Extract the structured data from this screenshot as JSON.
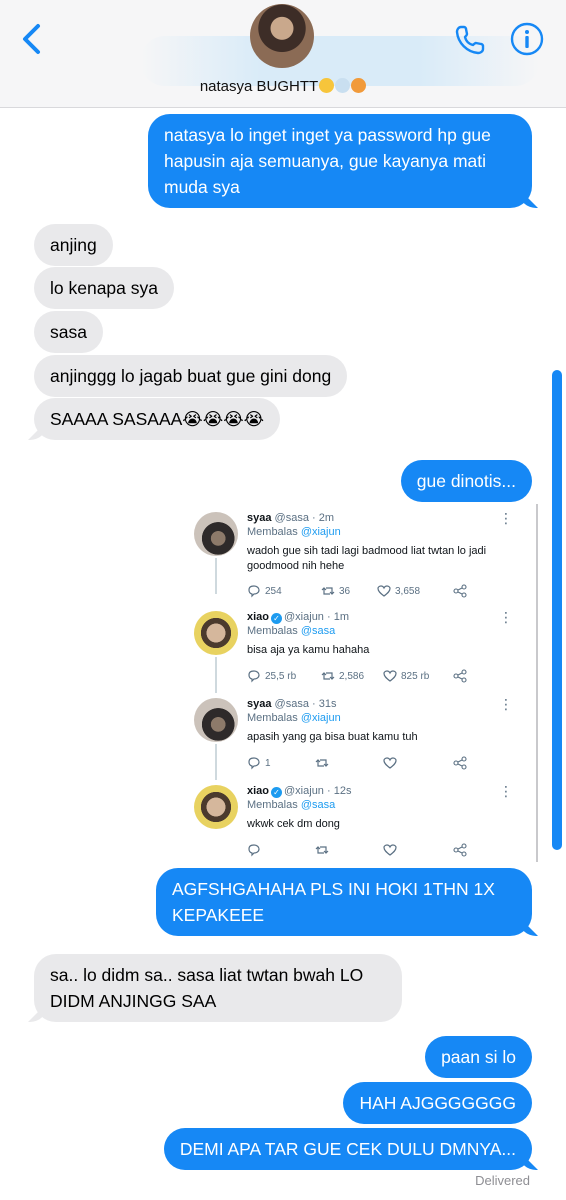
{
  "header": {
    "contact_name": "natasya BUGHTT",
    "emoji_names": [
      "hushed-face-emoji",
      "dash-emoji",
      "exploding-head-emoji"
    ],
    "back_icon": "chevron-left-icon",
    "call_icon": "phone-icon",
    "info_icon": "info-circle-icon",
    "accent_color": "#1688f5"
  },
  "messages": [
    {
      "dir": "out",
      "text": "natasya lo inget inget ya password hp gue hapusin aja semuanya, gue kayanya mati muda sya"
    },
    {
      "dir": "in",
      "text": "anjing"
    },
    {
      "dir": "in",
      "text": "lo kenapa sya"
    },
    {
      "dir": "in",
      "text": "sasa"
    },
    {
      "dir": "in",
      "text": "anjinggg lo jagab buat gue gini dong"
    },
    {
      "dir": "in",
      "text": "SAAAA SASAAA😭😭😭😭"
    },
    {
      "dir": "out",
      "text": "gue dinotis..."
    },
    {
      "dir": "out",
      "text": "AGFSHGAHAHA PLS INI HOKI 1THN 1X KEPAKEEE"
    },
    {
      "dir": "in",
      "text": "sa.. lo didm sa.. sasa liat twtan bwah LO DIDM ANJINGG SAA"
    },
    {
      "dir": "out",
      "text": "paan si lo"
    },
    {
      "dir": "out",
      "text": "HAH AJGGGGGGG"
    },
    {
      "dir": "out",
      "text": "DEMI APA TAR GUE CEK DULU DMNYA..."
    }
  ],
  "tweets": [
    {
      "name": "syaa",
      "handle": "@sasa",
      "time": "2m",
      "verified": false,
      "reply_prefix": "Membalas",
      "reply_to": "@xiajun",
      "text": "wadoh gue sih tadi lagi badmood liat twtan lo jadi goodmood nih hehe",
      "replies": "254",
      "retweets": "36",
      "likes": "3,658"
    },
    {
      "name": "xiao",
      "handle": "@xiajun",
      "time": "1m",
      "verified": true,
      "reply_prefix": "Membalas",
      "reply_to": "@sasa",
      "text": "bisa aja ya kamu hahaha",
      "replies": "25,5 rb",
      "retweets": "2,586",
      "likes": "825 rb"
    },
    {
      "name": "syaa",
      "handle": "@sasa",
      "time": "31s",
      "verified": false,
      "reply_prefix": "Membalas",
      "reply_to": "@xiajun",
      "text": "apasih yang ga bisa buat kamu tuh",
      "replies": "1",
      "retweets": "",
      "likes": ""
    },
    {
      "name": "xiao",
      "handle": "@xiajun",
      "time": "12s",
      "verified": true,
      "reply_prefix": "Membalas",
      "reply_to": "@sasa",
      "text": "wkwk cek dm dong",
      "replies": "",
      "retweets": "",
      "likes": ""
    }
  ],
  "status": {
    "delivered": "Delivered"
  }
}
